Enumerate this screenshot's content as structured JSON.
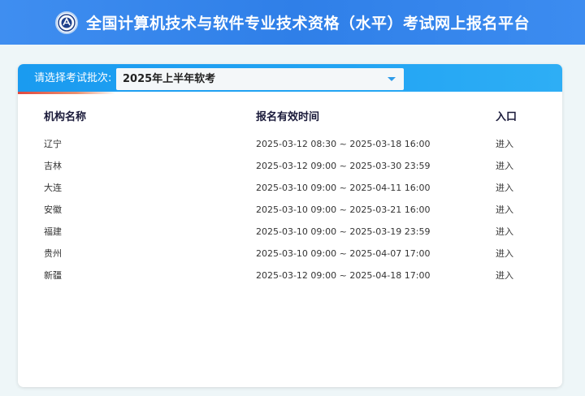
{
  "header": {
    "title": "全国计算机技术与软件专业技术资格（水平）考试网上报名平台"
  },
  "selector": {
    "label": "请选择考试批次:",
    "selected": "2025年上半年软考"
  },
  "table": {
    "columns": [
      "机构名称",
      "报名有效时间",
      "入口"
    ],
    "rows": [
      {
        "org": "辽宁",
        "time": "2025-03-12 08:30 ~ 2025-03-18 16:00",
        "entry": "进入"
      },
      {
        "org": "吉林",
        "time": "2025-03-12 09:00 ~ 2025-03-30 23:59",
        "entry": "进入"
      },
      {
        "org": "大连",
        "time": "2025-03-10 09:00 ~ 2025-04-11 16:00",
        "entry": "进入"
      },
      {
        "org": "安徽",
        "time": "2025-03-10 09:00 ~ 2025-03-21 16:00",
        "entry": "进入"
      },
      {
        "org": "福建",
        "time": "2025-03-10 09:00 ~ 2025-03-19 23:59",
        "entry": "进入"
      },
      {
        "org": "贵州",
        "time": "2025-03-10 09:00 ~ 2025-04-07 17:00",
        "entry": "进入"
      },
      {
        "org": "新疆",
        "time": "2025-03-12 09:00 ~ 2025-04-18 17:00",
        "entry": "进入"
      }
    ]
  },
  "colors": {
    "header_bg": "#3f8ef0",
    "selector_bar": "#1a9bf0",
    "page_bg": "#eef6f8",
    "accent_red": "#e0483f"
  },
  "icons": {
    "logo": "logo-emblem-icon",
    "dropdown": "caret-down-icon"
  }
}
